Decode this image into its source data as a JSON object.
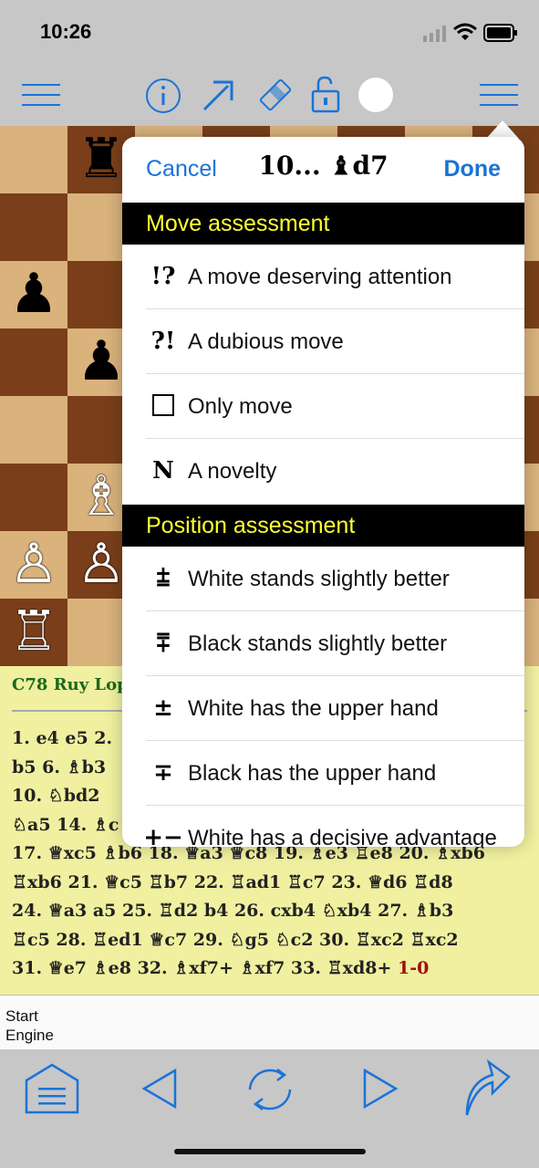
{
  "status": {
    "time": "10:26"
  },
  "popover": {
    "cancel_label": "Cancel",
    "title": "10... ♝d7",
    "done_label": "Done",
    "sections": [
      {
        "title": "Move assessment",
        "items": [
          {
            "symbol": "!?",
            "label": "A move deserving attention"
          },
          {
            "symbol": "?!",
            "label": "A dubious move"
          },
          {
            "symbol": "□",
            "label": "Only move"
          },
          {
            "symbol": "N",
            "label": "A novelty"
          }
        ]
      },
      {
        "title": "Position assessment",
        "items": [
          {
            "symbol": "⩲",
            "label": "White stands slightly better"
          },
          {
            "symbol": "⩱",
            "label": "Black stands slightly better"
          },
          {
            "symbol": "±",
            "label": "White has the upper hand"
          },
          {
            "symbol": "∓",
            "label": "Black has the upper hand"
          },
          {
            "symbol": "+−",
            "label": "White has a decisive advantage"
          }
        ]
      }
    ]
  },
  "notation": {
    "opening": "C78 Ruy Lop",
    "lines": [
      "1. e4 e5 2.",
      "b5 6. ♗b3",
      "10. ♘bd2",
      "♘a5 14. ♗c",
      "17. ♕xc5 ♗b6 18. ♕a3 ♕c8 19. ♗e3 ♖e8 20. ♗xb6",
      "♖xb6 21. ♕c5 ♖b7 22. ♖ad1 ♖c7 23. ♕d6 ♖d8",
      "24. ♕a3 a5 25. ♖d2 b4 26. cxb4 ♘xb4 27. ♗b3",
      "♖c5 28. ♖ed1 ♕c7 29. ♘g5 ♘c2 30. ♖xc2 ♖xc2",
      "31. ♕e7 ♗e8 32. ♗xf7+ ♗xf7 33. ♖xd8+"
    ],
    "result": "1-0"
  },
  "engine": {
    "label": "Start Engine"
  },
  "icons": {
    "toolbar": [
      "menu-icon",
      "info-icon",
      "arrow-icon",
      "eraser-icon",
      "unlock-icon",
      "color-dot-icon",
      "menu-icon"
    ],
    "bottom": [
      "home-icon",
      "back-icon",
      "flip-icon",
      "forward-icon",
      "share-icon"
    ]
  },
  "colors": {
    "accent": "#1a73d8",
    "section_text": "#ffff33",
    "notation_bg": "#f0f0a0"
  }
}
